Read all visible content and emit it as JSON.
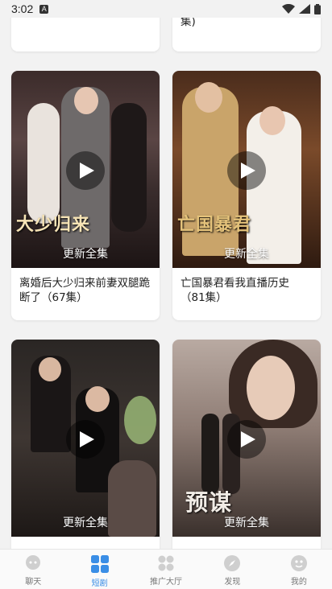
{
  "status": {
    "time": "3:02",
    "notif": "A"
  },
  "cards_top": [
    {
      "title": "…"
    },
    {
      "title": "集)"
    }
  ],
  "cards": [
    {
      "badge": "更新全集",
      "overlay": "大少归来",
      "title": "离婚后大少归来前妻双腿跪断了（67集）"
    },
    {
      "badge": "更新全集",
      "overlay": "亡国暴君",
      "title": "亡国暴君看我直播历史（81集）"
    },
    {
      "badge": "更新全集",
      "overlay": "",
      "title": ""
    },
    {
      "badge": "更新全集",
      "overlay": "预谋",
      "title": ""
    }
  ],
  "tabs": [
    {
      "label": "聊天",
      "icon": "chat-icon",
      "active": false
    },
    {
      "label": "短剧",
      "icon": "grid-icon",
      "active": true
    },
    {
      "label": "推广大厅",
      "icon": "apps-icon",
      "active": false
    },
    {
      "label": "发现",
      "icon": "compass-icon",
      "active": false
    },
    {
      "label": "我的",
      "icon": "profile-icon",
      "active": false
    }
  ],
  "colors": {
    "accent": "#3a8ee6",
    "inactive": "#c9c9c9"
  }
}
